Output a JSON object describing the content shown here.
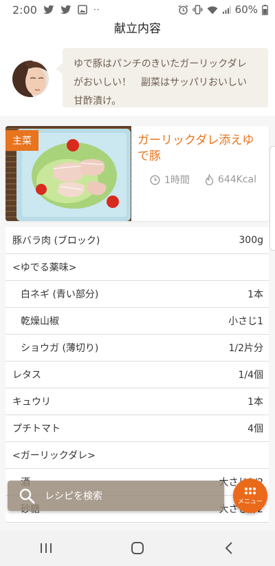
{
  "status": {
    "time": "2:00",
    "battery": "60%",
    "left_icons": [
      "twitter-icon",
      "twitter-icon",
      "image-icon",
      "more-dots-icon"
    ],
    "right_icons": [
      "alarm-icon",
      "vibrate-icon",
      "wifi-icon",
      "signal-icon",
      "battery-icon"
    ]
  },
  "header": {
    "title": "献立内容"
  },
  "intro": {
    "message_lines": [
      "ゆで豚はパンチのきいたガーリックダレ",
      "がおいしい！　副菜はサッパリおいしい",
      "甘酢漬け。"
    ]
  },
  "recipe": {
    "tag": "主菜",
    "title": "ガーリックダレ添えゆで豚",
    "time": "1時間",
    "calories": "644Kcal"
  },
  "ingredients": [
    {
      "name": "豚バラ肉 (ブロック)",
      "amount": "300g",
      "indent": false
    },
    {
      "name": "<ゆでる薬味>",
      "amount": "",
      "indent": false
    },
    {
      "name": "白ネギ (青い部分)",
      "amount": "1本",
      "indent": true
    },
    {
      "name": "乾燥山椒",
      "amount": "小さじ1",
      "indent": true
    },
    {
      "name": "ショウガ (薄切り)",
      "amount": "1/2片分",
      "indent": true
    },
    {
      "name": "レタス",
      "amount": "1/4個",
      "indent": false
    },
    {
      "name": "キュウリ",
      "amount": "1本",
      "indent": false
    },
    {
      "name": "プチトマト",
      "amount": "4個",
      "indent": false
    },
    {
      "name": "<ガーリックダレ>",
      "amount": "",
      "indent": false
    },
    {
      "name": "酒",
      "amount": "大さじ1/2",
      "indent": true
    },
    {
      "name": "砂糖",
      "amount": "大さじ1/2",
      "indent": true
    }
  ],
  "search": {
    "label": "レシピを検索"
  },
  "menu_button": {
    "label": "メニュー"
  },
  "colors": {
    "accent": "#e8741e",
    "fab": "#ea6a1a",
    "bubble": "#f3efe9"
  }
}
